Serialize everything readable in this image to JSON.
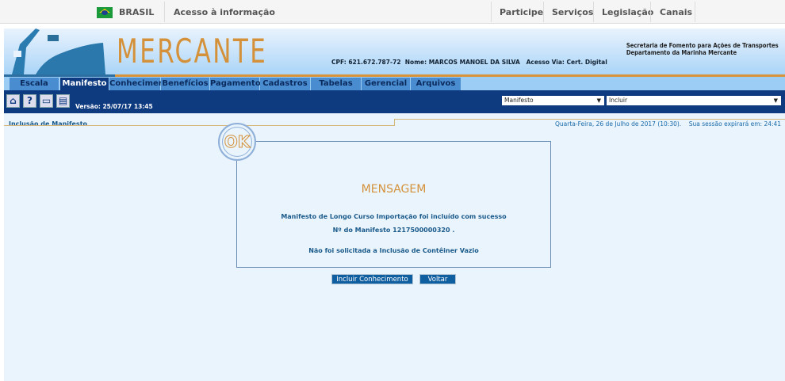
{
  "gov_bar": {
    "country": "BRASIL",
    "access_info": "Acesso à informação",
    "links": [
      "Participe",
      "Serviços",
      "Legislação",
      "Canais"
    ]
  },
  "header": {
    "logo": "MERCANTE",
    "user_info": "CPF: 621.672.787-72  Nome: MARCOS MANOEL DA SILVA   Acesso Via: Cert. Digital",
    "secretaria": [
      "Secretaria de Fomento para Ações de Transportes",
      "Departamento da Marinha Mercante"
    ]
  },
  "tabs": [
    "Escala",
    "Manifesto",
    "Conhecimento",
    "Benefícios",
    "Pagamento",
    "Cadastros",
    "Tabelas",
    "Gerencial",
    "Arquivos"
  ],
  "toolbar": {
    "version": "Versão: 25/07/17 13:45",
    "select_module": "Manifesto",
    "select_action": "Incluir"
  },
  "page": {
    "breadcrumb": "Inclusão de Manifesto",
    "date": "Quarta-Feira, 26 de Julho de 2017 (10:30).",
    "session": "Sua sessão expirará em: 24:41"
  },
  "message": {
    "badge": "OK",
    "title": "MENSAGEM",
    "line1": "Manifesto de Longo Curso Importação foi incluído com sucesso",
    "line2": "Nº do Manifesto 1217500000320 .",
    "line3": "Não foi solicitada a Inclusão de Contêiner Vazio"
  },
  "buttons": {
    "incluir": "Incluir Conhecimento",
    "voltar": "Voltar"
  }
}
